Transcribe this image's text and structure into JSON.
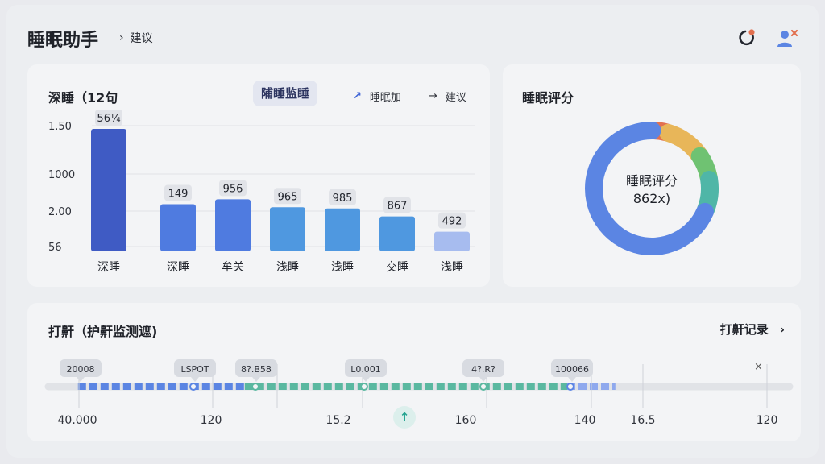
{
  "header": {
    "title": "睡眠助手",
    "breadcrumb": "建议"
  },
  "main_card": {
    "title": "深睡（12句",
    "monitor_button": "陠睡监睡",
    "action_1": "睡眠加",
    "action_2": "建议"
  },
  "score_card": {
    "title": "睡眠评分",
    "center_title": "睡眠评分",
    "center_value": "862x)"
  },
  "snore_card": {
    "title": "打鼾（护鼾监测遮)",
    "link": "打鼾记录"
  },
  "colors": {
    "bar_dark": "#3f5bc4",
    "bar_mid": "#4f7be0",
    "bar_light": "#4f98e0",
    "bar_faint": "#a7bcef",
    "accent_blue": "#5b85e3",
    "accent_teal": "#5ab8a0"
  },
  "chart_data": {
    "type": "bar",
    "y_tick_labels": [
      "1.50",
      "1000",
      "2.00",
      "56"
    ],
    "categories": [
      "深睡",
      "深睡",
      "牟关",
      "浅睡",
      "浅睡",
      "交睡",
      "浅睡"
    ],
    "values": [
      564,
      149,
      956,
      965,
      985,
      867,
      492
    ],
    "data_labels": [
      "56¼",
      "149",
      "956",
      "965",
      "985",
      "867",
      "492"
    ],
    "bar_colors": [
      "#3f5bc4",
      "#4f7be0",
      "#4f7be0",
      "#4f98e0",
      "#4f98e0",
      "#4f98e0",
      "#a7bcef"
    ]
  },
  "donut_data": {
    "segments": [
      {
        "color": "#e2704f",
        "value": 4
      },
      {
        "color": "#e8b659",
        "value": 11
      },
      {
        "color": "#6fc272",
        "value": 7
      },
      {
        "color": "#4fb6a7",
        "value": 9
      },
      {
        "color": "#5b85e3",
        "value": 69
      }
    ]
  },
  "timeline": {
    "markers": [
      "20008",
      "LSPOT",
      "8?.B58",
      "L0.001",
      "4?.R?",
      "100066"
    ],
    "axis_labels": [
      "40.000",
      "120",
      "15.2",
      "160",
      "140",
      "16.5",
      "120"
    ],
    "close_label": "×",
    "play_label": "↑",
    "segments": [
      {
        "color": "#5b85e3",
        "from": 0.04,
        "to": 0.265
      },
      {
        "color": "#5ab8a0",
        "from": 0.265,
        "to": 0.7
      },
      {
        "color": "#8fa9ee",
        "from": 0.7,
        "to": 0.765
      }
    ]
  }
}
